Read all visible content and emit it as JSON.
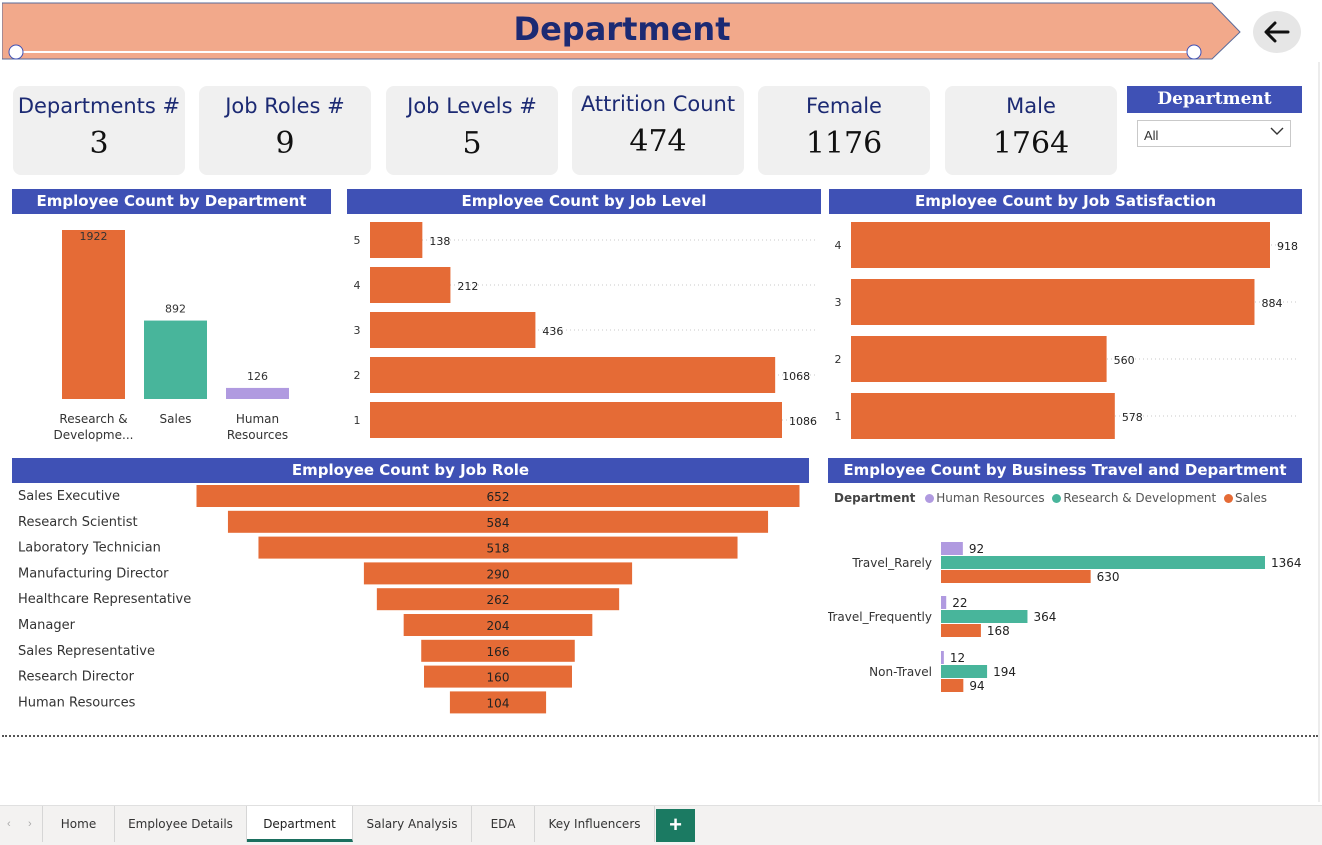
{
  "header": {
    "title": "Department"
  },
  "kpis": [
    {
      "label": "Departments #",
      "value": "3"
    },
    {
      "label": "Job Roles #",
      "value": "9"
    },
    {
      "label": "Job Levels #",
      "value": "5"
    },
    {
      "label": "Attrition Count",
      "value": "474"
    },
    {
      "label": "Female",
      "value": "1176"
    },
    {
      "label": "Male",
      "value": "1764"
    }
  ],
  "slicer": {
    "title": "Department",
    "selected": "All"
  },
  "colors": {
    "orange": "#e56b36",
    "teal": "#48b59b",
    "lavender": "#b09ae0",
    "title_bar": "#3f51b5",
    "title_text": "#1c2a73",
    "banner": "#f2a98b"
  },
  "chart_data": [
    {
      "type": "bar",
      "title": "Employee Count by Department",
      "categories": [
        "Research & Developme...",
        "Sales",
        "Human Resources"
      ],
      "values": [
        1922,
        892,
        126
      ],
      "colors": [
        "#e56b36",
        "#48b59b",
        "#b09ae0"
      ]
    },
    {
      "type": "bar",
      "orientation": "horizontal",
      "title": "Employee Count by Job Level",
      "categories": [
        "5",
        "4",
        "3",
        "2",
        "1"
      ],
      "values": [
        138,
        212,
        436,
        1068,
        1086
      ]
    },
    {
      "type": "bar",
      "orientation": "horizontal",
      "title": "Employee Count by Job Satisfaction",
      "categories": [
        "4",
        "3",
        "2",
        "1"
      ],
      "values": [
        918,
        884,
        560,
        578
      ]
    },
    {
      "type": "bar",
      "subtype": "funnel",
      "title": "Employee Count by Job Role",
      "categories": [
        "Sales Executive",
        "Research Scientist",
        "Laboratory Technician",
        "Manufacturing Director",
        "Healthcare Representative",
        "Manager",
        "Sales Representative",
        "Research Director",
        "Human Resources"
      ],
      "values": [
        652,
        584,
        518,
        290,
        262,
        204,
        166,
        160,
        104
      ]
    },
    {
      "type": "bar",
      "orientation": "horizontal",
      "title": "Employee Count by Business Travel and Department",
      "legend_title": "Department",
      "categories": [
        "Travel_Rarely",
        "Travel_Frequently",
        "Non-Travel"
      ],
      "series": [
        {
          "name": "Human Resources",
          "values": [
            92,
            22,
            12
          ],
          "color": "#b09ae0"
        },
        {
          "name": "Research & Development",
          "values": [
            1364,
            364,
            194
          ],
          "color": "#48b59b"
        },
        {
          "name": "Sales",
          "values": [
            630,
            168,
            94
          ],
          "color": "#e56b36"
        }
      ]
    }
  ],
  "tabs": [
    "Home",
    "Employee Details",
    "Department",
    "Salary Analysis",
    "EDA",
    "Key Influencers"
  ],
  "active_tab": "Department",
  "add_tab_label": "+",
  "nav_arrows": [
    "‹",
    "›"
  ]
}
